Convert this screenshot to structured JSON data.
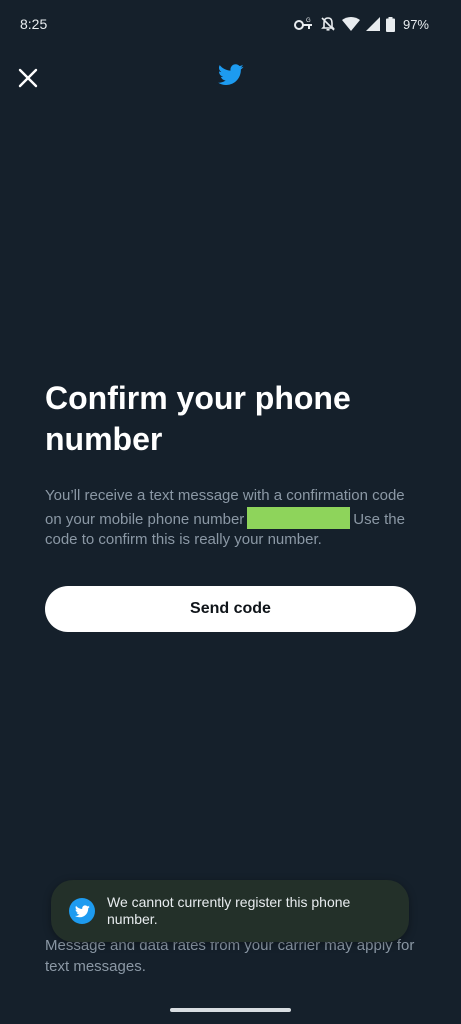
{
  "status_bar": {
    "time": "8:25",
    "battery": "97%",
    "icons": [
      "vpn-key-icon",
      "notifications-off-icon",
      "wifi-icon",
      "cell-signal-icon",
      "battery-icon"
    ]
  },
  "header": {
    "close_icon": "close-icon",
    "logo_icon": "twitter-bird-icon",
    "brand_color": "#1d9bf0"
  },
  "main": {
    "title": "Confirm your phone number",
    "description_before": "You’ll receive a text message with a confirmation code on your mobile phone number",
    "description_after": "Use the code to confirm this is really your number.",
    "send_button": "Send code"
  },
  "footer": {
    "disclaimer": "Message and data rates from your carrier may apply for text messages."
  },
  "toast": {
    "message": "We cannot currently register this phone number.",
    "icon": "twitter-bird-icon"
  },
  "colors": {
    "background": "#15202b",
    "secondary_text": "#8b98a5",
    "redaction": "#8ed45b"
  }
}
